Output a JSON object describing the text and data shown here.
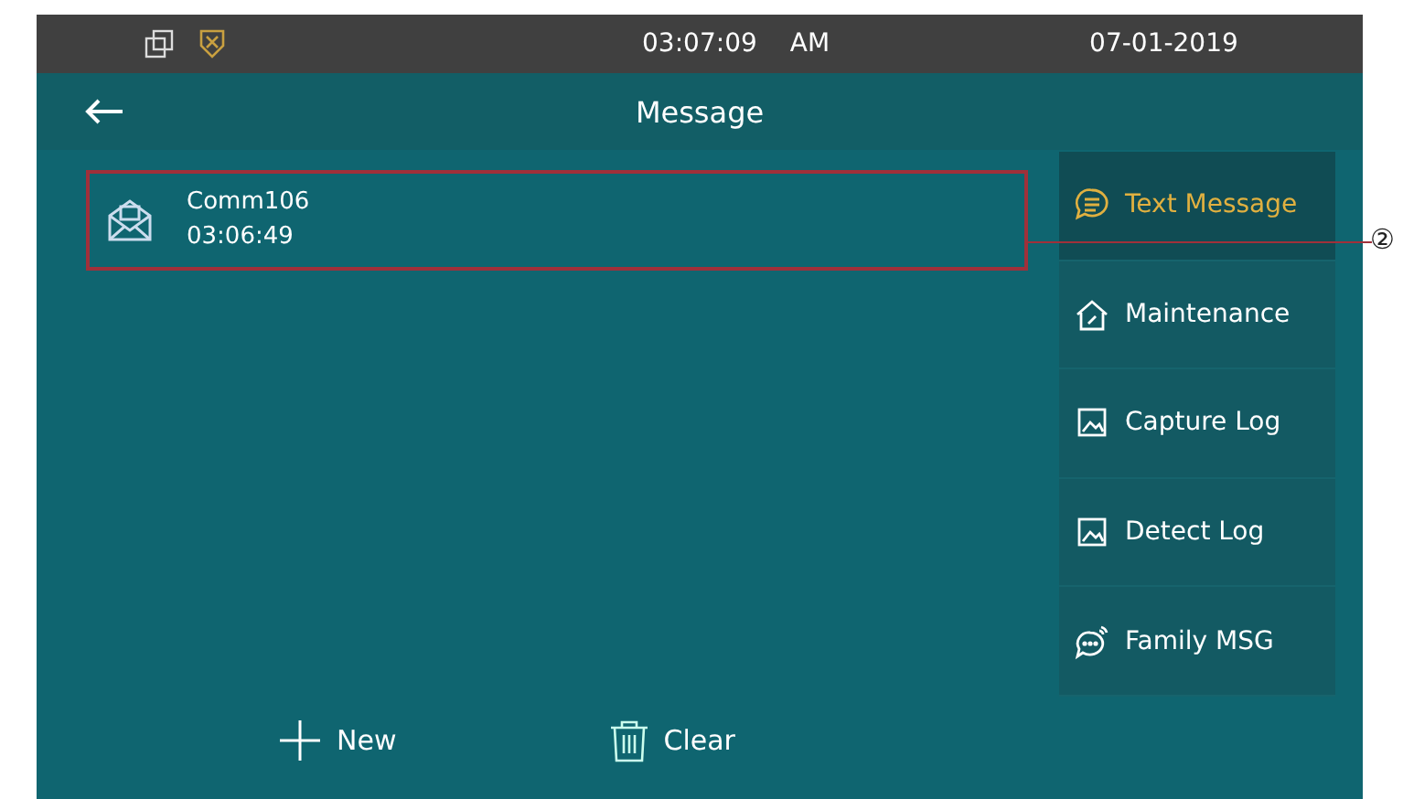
{
  "status_bar": {
    "time": "03:07:09",
    "meridiem": "AM",
    "date": "07-01-2019"
  },
  "header": {
    "title": "Message"
  },
  "messages": [
    {
      "name": "Comm106",
      "time": "03:06:49",
      "highlighted": true
    }
  ],
  "sidebar": {
    "items": [
      {
        "label": "Text Message",
        "kind": "chat",
        "selected": true
      },
      {
        "label": "Maintenance",
        "kind": "house",
        "selected": false
      },
      {
        "label": "Capture Log",
        "kind": "image",
        "selected": false
      },
      {
        "label": "Detect Log",
        "kind": "image",
        "selected": false
      },
      {
        "label": "Family MSG",
        "kind": "signal",
        "selected": false
      }
    ]
  },
  "actions": [
    {
      "label": "New",
      "kind": "plus"
    },
    {
      "label": "Clear",
      "kind": "trash"
    }
  ],
  "callout": {
    "label": "②"
  }
}
